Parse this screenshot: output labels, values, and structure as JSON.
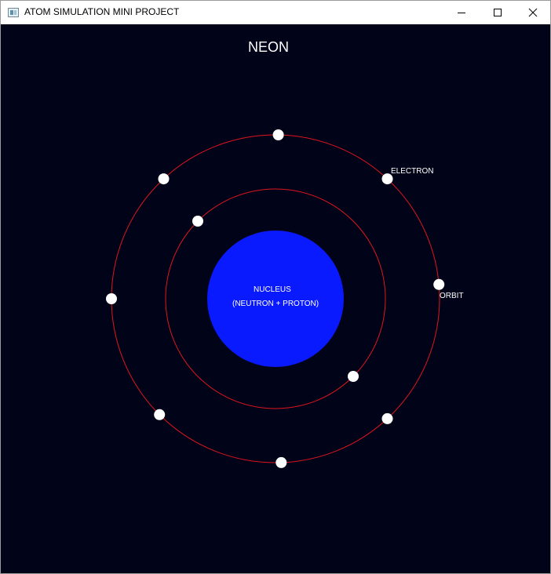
{
  "window": {
    "title": "ATOM SIMULATION MINI PROJECT",
    "controls": {
      "minimize": "minimize-icon",
      "maximize": "maximize-icon",
      "close": "close-icon"
    }
  },
  "scene": {
    "element_name": "NEON",
    "nucleus_label": "NUCLEUS",
    "nucleus_sublabel": "(NEUTRON + PROTON)",
    "electron_label": "ELECTRON",
    "orbit_label": "ORBIT",
    "colors": {
      "background": "#010419",
      "nucleus": "#0a1aff",
      "orbit": "#e0141e",
      "electron": "#ffffff",
      "text": "#ffffff"
    },
    "inner_shell_electrons": 2,
    "outer_shell_electrons": 8
  }
}
